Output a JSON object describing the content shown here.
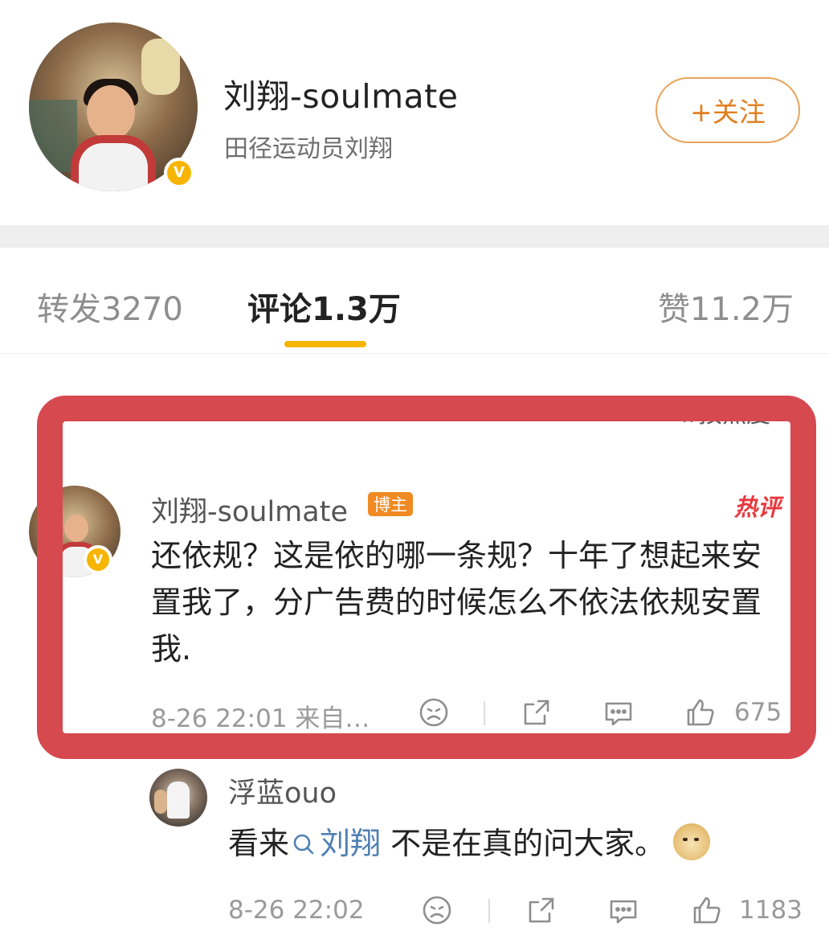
{
  "profile": {
    "name": "刘翔-soulmate",
    "description": "田径运动员刘翔",
    "follow_label": "+关注",
    "verified_badge_color": "#f7b500"
  },
  "tabs": {
    "repost": "转发3270",
    "comments": "评论1.3万",
    "likes": "赞11.2万",
    "active": "comments",
    "active_indicator_color": "#f7b500"
  },
  "sort_stub": "⇅按热度",
  "highlight_color": "#d6494f",
  "comments": [
    {
      "author": "刘翔-soulmate",
      "author_badge": "博主",
      "hot_tag": "热评",
      "text": "还依规？这是依的哪一条规？十年了想起来安置我了，分广告费的时候怎么不依法依规安置我.",
      "time": "8-26 22:01 来自…",
      "like_count": "675",
      "icons": [
        "sad-face-icon",
        "share-icon",
        "comment-icon",
        "thumbs-up-icon"
      ]
    },
    {
      "author": "浮蓝ouo",
      "text_before": "看来",
      "mention": "刘翔",
      "text_after": " 不是在真的问大家。",
      "time": "8-26 22:02",
      "like_count": "1183",
      "icons": [
        "sad-face-icon",
        "share-icon",
        "comment-icon",
        "thumbs-up-icon"
      ]
    }
  ],
  "colors": {
    "follow_accent": "#e07f1e",
    "mention_link": "#4f7fb3",
    "hot_red": "#e6393f",
    "host_badge": "#f08a24"
  }
}
